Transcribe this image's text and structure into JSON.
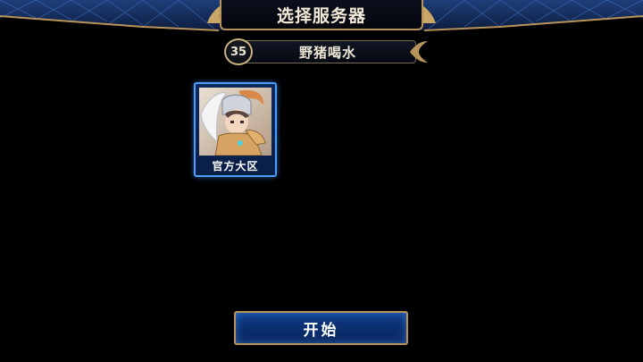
{
  "header": {
    "title": "选择服务器"
  },
  "player": {
    "level": "35",
    "name": "野猪喝水"
  },
  "servers": [
    {
      "label": "官方大区"
    }
  ],
  "actions": {
    "start_label": "开始"
  },
  "colors": {
    "accent_gold": "#b8935a",
    "card_border": "#4f9cff",
    "button_blue": "#0f3d8a",
    "background": "#000000"
  }
}
